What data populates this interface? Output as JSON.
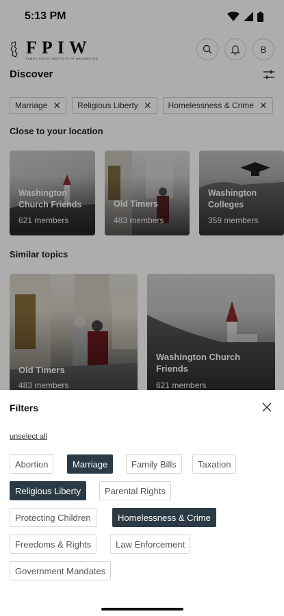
{
  "status": {
    "time": "5:13 PM"
  },
  "header": {
    "logo_text": "FPIW",
    "logo_subtitle": "FAMILY POLICY INSTITUTE OF WASHINGTON",
    "avatar_initial": "B"
  },
  "discover": {
    "title": "Discover",
    "chips": [
      {
        "label": "Marriage"
      },
      {
        "label": "Religious Liberty"
      },
      {
        "label": "Homelessness & Crime"
      }
    ]
  },
  "close_section": {
    "title": "Close to your location",
    "cards": [
      {
        "title_line1": "Washington",
        "title_line2": "Church Friends",
        "members": "621 members"
      },
      {
        "title_line1": "Old Timers",
        "title_line2": "",
        "members": "483 members"
      },
      {
        "title_line1": "Washington",
        "title_line2": "Colleges",
        "members": "359 members"
      }
    ]
  },
  "similar_section": {
    "title": "Similar topics",
    "cards": [
      {
        "title_line1": "Old Timers",
        "title_line2": "",
        "members": "483 members"
      },
      {
        "title_line1": "Washington Church",
        "title_line2": "Friends",
        "members": "621 members"
      }
    ]
  },
  "filters": {
    "title": "Filters",
    "unselect_label": "unselect all",
    "tags": [
      {
        "label": "Abortion",
        "selected": false
      },
      {
        "label": "Marriage",
        "selected": true
      },
      {
        "label": "Family Bills",
        "selected": false
      },
      {
        "label": "Taxation",
        "selected": false
      },
      {
        "label": "Religious Liberty",
        "selected": true
      },
      {
        "label": "Parental Rights",
        "selected": false
      },
      {
        "label": "Protecting Children",
        "selected": false
      },
      {
        "label": "Homelessness & Crime",
        "selected": true
      },
      {
        "label": "Freedoms & Rights",
        "selected": false
      },
      {
        "label": "Law Enforcement",
        "selected": false
      },
      {
        "label": "Government Mandates",
        "selected": false
      }
    ]
  },
  "colors": {
    "selected_tag_bg": "#2b3a44",
    "overlay": "rgba(0,0,0,0.32)"
  }
}
